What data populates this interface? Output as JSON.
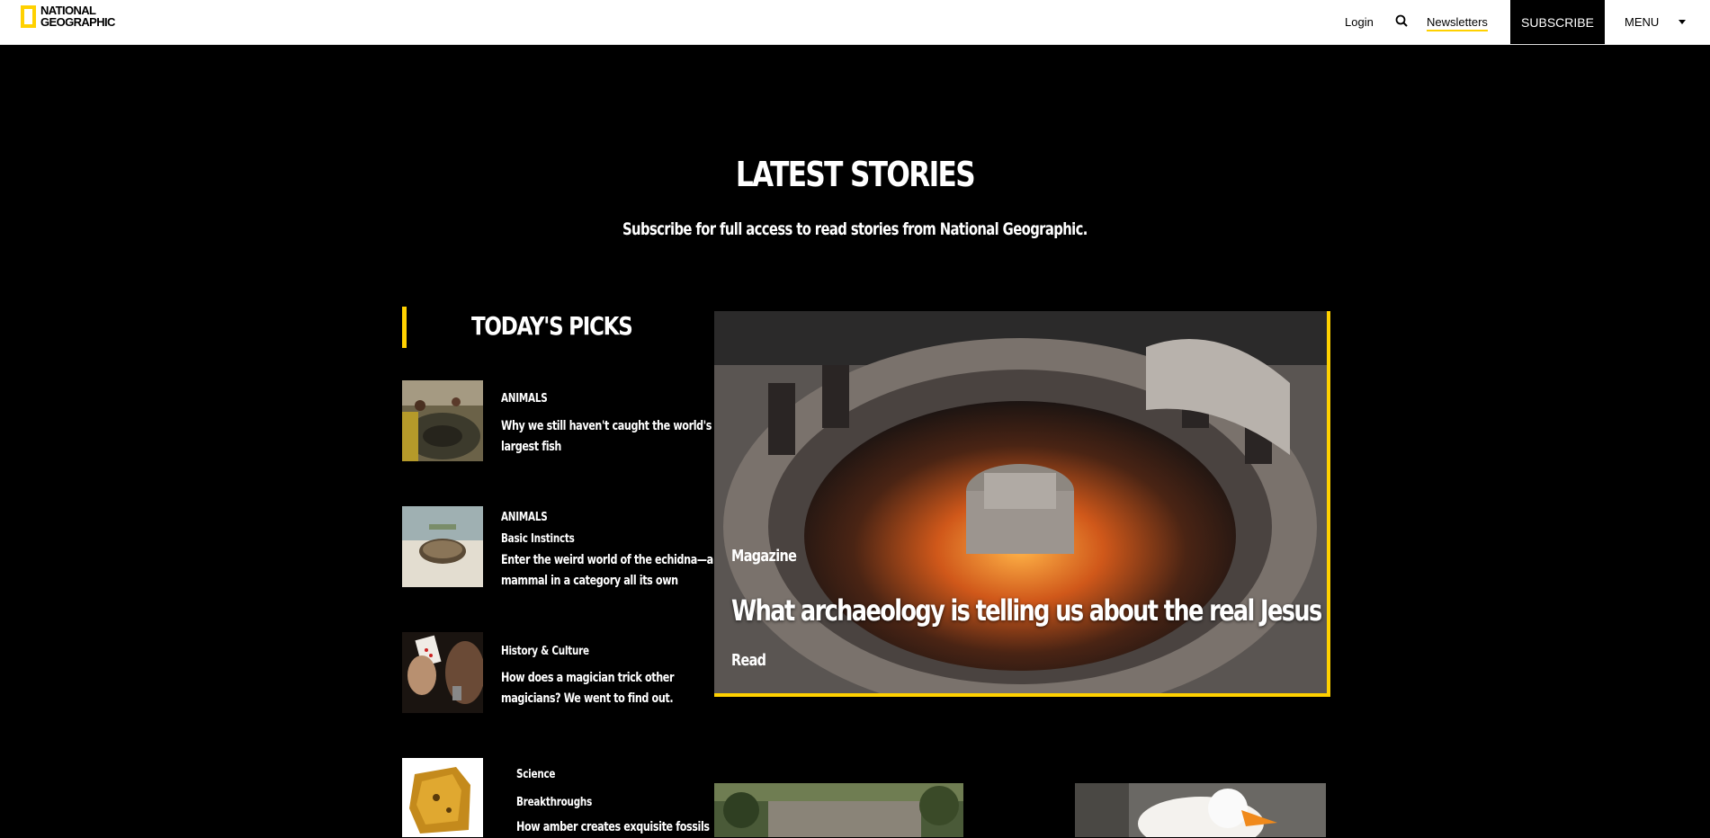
{
  "header": {
    "logo_line1": "NATIONAL",
    "logo_line2": "GEOGRAPHIC",
    "login": "Login",
    "newsletters": "Newsletters",
    "subscribe": "SUBSCRIBE",
    "menu": "MENU",
    "brand_color": "#ffd100"
  },
  "hero_section": {
    "heading": "LATEST STORIES",
    "subheading": "Subscribe for full access to read stories from National Geographic."
  },
  "todays_picks": {
    "title": "TODAY'S PICKS",
    "items": [
      {
        "category": "ANIMALS",
        "title_line1": "Why we still haven't caught the world's",
        "title_line2": "largest fish"
      },
      {
        "category": "ANIMALS",
        "series": "Basic Instincts",
        "title_line1": "Enter the weird world of the echidna—a",
        "title_line2": "mammal in a category all its own"
      },
      {
        "category": "History & Culture",
        "title_line1": "How does a magician trick other",
        "title_line2": "magicians? We went to find out."
      },
      {
        "category": "Science",
        "series": "Breakthroughs",
        "title_line1": "How amber creates exquisite fossils"
      }
    ]
  },
  "feature": {
    "kicker": "Magazine",
    "title": "What archaeology is telling us about the real Jesus",
    "cta": "Read"
  }
}
